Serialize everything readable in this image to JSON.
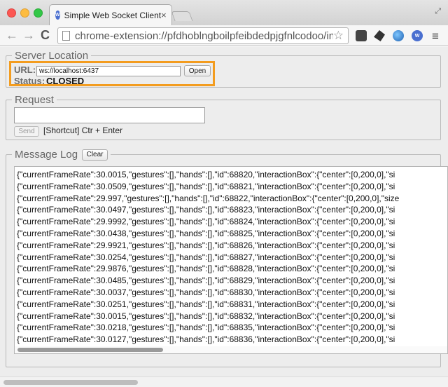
{
  "browser": {
    "tab_title": "Simple Web Socket Client",
    "favicon_text": "W",
    "close_glyph": "×",
    "address": "chrome-extension://pfdhoblngboilpfeibdedpjgfnlcodoo/in...",
    "icons": {
      "back": "←",
      "forward": "→",
      "reload": "C",
      "star": "☆",
      "menu": "≡",
      "resize": "⤢"
    }
  },
  "server_location": {
    "legend": "Server Location",
    "url_label": "URL:",
    "url_value": "ws://localhost:6437",
    "open_button": "Open",
    "status_label": "Status:",
    "status_value": "CLOSED",
    "highlight_color": "#f39c1f"
  },
  "request": {
    "legend": "Request",
    "textarea_value": "",
    "send_button": "Send",
    "shortcut_text": "[Shortcut] Ctr + Enter"
  },
  "message_log": {
    "legend": "Message Log",
    "clear_button": "Clear",
    "lines": [
      "{\"currentFrameRate\":30.0015,\"gestures\":[],\"hands\":[],\"id\":68820,\"interactionBox\":{\"center\":[0,200,0],\"si",
      "{\"currentFrameRate\":30.0509,\"gestures\":[],\"hands\":[],\"id\":68821,\"interactionBox\":{\"center\":[0,200,0],\"si",
      "{\"currentFrameRate\":29.997,\"gestures\":[],\"hands\":[],\"id\":68822,\"interactionBox\":{\"center\":[0,200,0],\"size",
      "{\"currentFrameRate\":30.0497,\"gestures\":[],\"hands\":[],\"id\":68823,\"interactionBox\":{\"center\":[0,200,0],\"si",
      "{\"currentFrameRate\":29.9992,\"gestures\":[],\"hands\":[],\"id\":68824,\"interactionBox\":{\"center\":[0,200,0],\"si",
      "{\"currentFrameRate\":30.0438,\"gestures\":[],\"hands\":[],\"id\":68825,\"interactionBox\":{\"center\":[0,200,0],\"si",
      "{\"currentFrameRate\":29.9921,\"gestures\":[],\"hands\":[],\"id\":68826,\"interactionBox\":{\"center\":[0,200,0],\"si",
      "{\"currentFrameRate\":30.0254,\"gestures\":[],\"hands\":[],\"id\":68827,\"interactionBox\":{\"center\":[0,200,0],\"si",
      "{\"currentFrameRate\":29.9876,\"gestures\":[],\"hands\":[],\"id\":68828,\"interactionBox\":{\"center\":[0,200,0],\"si",
      "{\"currentFrameRate\":30.0485,\"gestures\":[],\"hands\":[],\"id\":68829,\"interactionBox\":{\"center\":[0,200,0],\"si",
      "{\"currentFrameRate\":30.0037,\"gestures\":[],\"hands\":[],\"id\":68830,\"interactionBox\":{\"center\":[0,200,0],\"si",
      "{\"currentFrameRate\":30.0251,\"gestures\":[],\"hands\":[],\"id\":68831,\"interactionBox\":{\"center\":[0,200,0],\"si",
      "{\"currentFrameRate\":30.0015,\"gestures\":[],\"hands\":[],\"id\":68832,\"interactionBox\":{\"center\":[0,200,0],\"si",
      "{\"currentFrameRate\":30.0218,\"gestures\":[],\"hands\":[],\"id\":68835,\"interactionBox\":{\"center\":[0,200,0],\"si",
      "{\"currentFrameRate\":30.0127,\"gestures\":[],\"hands\":[],\"id\":68836,\"interactionBox\":{\"center\":[0,200,0],\"si"
    ]
  }
}
